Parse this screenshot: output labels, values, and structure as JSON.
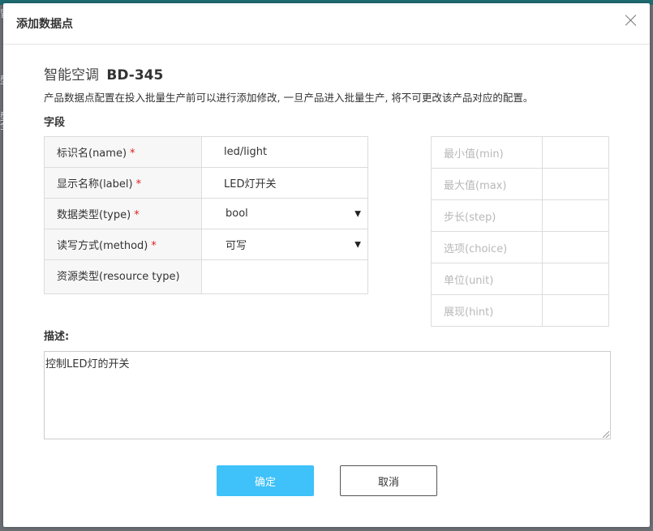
{
  "backdrop": {
    "chars": [
      "冒",
      "型",
      "型",
      "全"
    ]
  },
  "dialog": {
    "title": "添加数据点",
    "product_name": "智能空调",
    "product_code": "BD-345",
    "notice": "产品数据点配置在投入批量生产前可以进行添加修改, 一旦产品进入批量生产, 将不可更改该产品对应的配置。",
    "fields_section_label": "字段",
    "fields": [
      {
        "label": "标识名(name)",
        "required": "*",
        "value": "led/light"
      },
      {
        "label": "显示名称(label)",
        "required": "*",
        "value": "LED灯开关"
      },
      {
        "label": "数据类型(type)",
        "required": "*",
        "value": "bool",
        "dropdown": true
      },
      {
        "label": "读写方式(method)",
        "required": "*",
        "value": "可写",
        "dropdown": true
      },
      {
        "label": "资源类型(resource type)",
        "required": "",
        "value": ""
      }
    ],
    "extra_fields": [
      {
        "label": "最小值(min)"
      },
      {
        "label": "最大值(max)"
      },
      {
        "label": "步长(step)"
      },
      {
        "label": "选项(choice)"
      },
      {
        "label": "单位(unit)"
      },
      {
        "label": "展现(hint)"
      }
    ],
    "description_label": "描述:",
    "description_value": "控制LED灯的开关",
    "buttons": {
      "confirm": "确定",
      "cancel": "取消"
    },
    "dropdown_glyph": "▼"
  }
}
